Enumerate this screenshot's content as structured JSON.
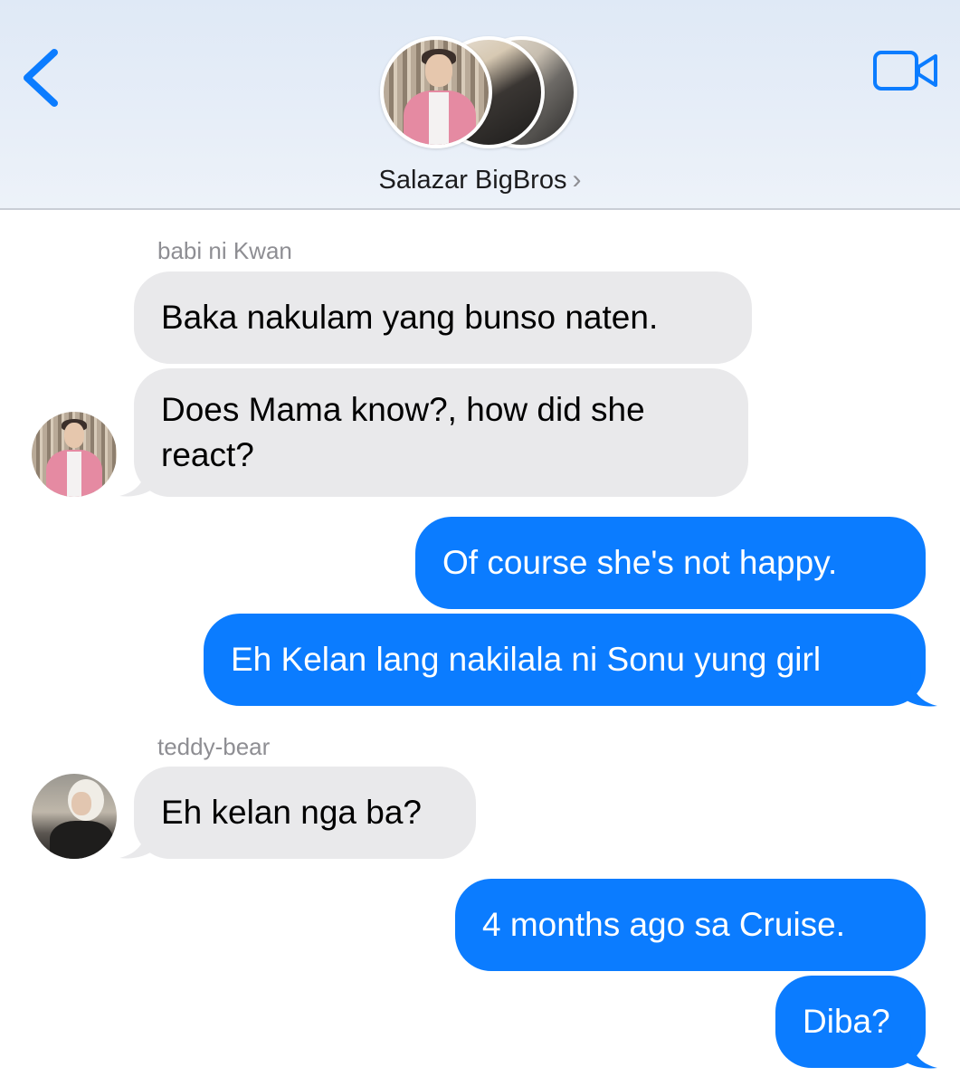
{
  "header": {
    "title": "Salazar BigBros",
    "chevron": "›"
  },
  "messages": [
    {
      "sender": "babi ni Kwan",
      "text": "Baka nakulam yang bunso naten.",
      "direction": "in"
    },
    {
      "text": "Does Mama know?, how did she react?",
      "direction": "in"
    },
    {
      "text": "Of course she's not happy.",
      "direction": "out"
    },
    {
      "text": "Eh Kelan lang nakilala ni Sonu yung girl",
      "direction": "out"
    },
    {
      "sender": "teddy-bear",
      "text": "Eh kelan nga ba?",
      "direction": "in"
    },
    {
      "text": "4 months ago sa Cruise.",
      "direction": "out"
    },
    {
      "text": "Diba?",
      "direction": "out"
    }
  ],
  "colors": {
    "accent": "#0b7cff",
    "incoming_bubble": "#e9e9eb",
    "header_bg": "#e4ecf7",
    "sender_name": "#8e8e93"
  },
  "icons": [
    "back-chevron-icon",
    "video-call-icon"
  ]
}
